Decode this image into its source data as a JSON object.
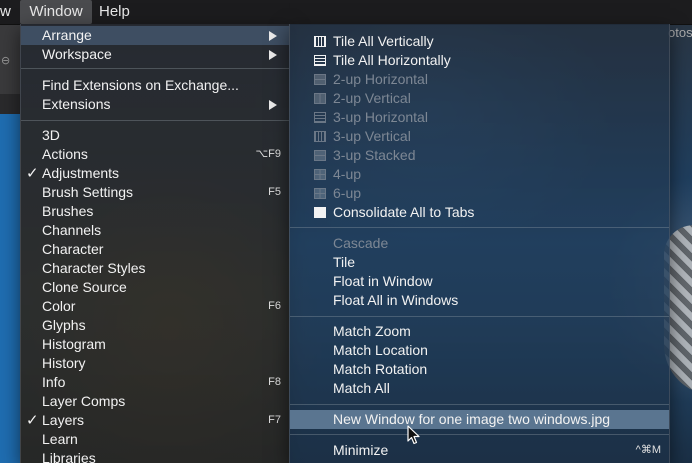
{
  "menubar": {
    "prev_fragment": "w",
    "window": "Window",
    "help": "Help"
  },
  "right_tab": "otos",
  "window_menu": {
    "items": [
      {
        "label": "Arrange",
        "submenu": true
      },
      {
        "label": "Workspace",
        "submenu": true
      },
      {
        "label": "Find Extensions on Exchange..."
      },
      {
        "label": "Extensions",
        "submenu": true
      },
      {
        "label": "3D"
      },
      {
        "label": "Actions",
        "shortcut": "⌥F9"
      },
      {
        "label": "Adjustments",
        "checked": true
      },
      {
        "label": "Brush Settings",
        "shortcut": "F5"
      },
      {
        "label": "Brushes"
      },
      {
        "label": "Channels"
      },
      {
        "label": "Character"
      },
      {
        "label": "Character Styles"
      },
      {
        "label": "Clone Source"
      },
      {
        "label": "Color",
        "shortcut": "F6"
      },
      {
        "label": "Glyphs"
      },
      {
        "label": "Histogram"
      },
      {
        "label": "History"
      },
      {
        "label": "Info",
        "shortcut": "F8"
      },
      {
        "label": "Layer Comps"
      },
      {
        "label": "Layers",
        "shortcut": "F7",
        "checked": true
      },
      {
        "label": "Learn"
      },
      {
        "label": "Libraries"
      }
    ],
    "check_glyph": "✓"
  },
  "arrange_menu": {
    "items": [
      {
        "label": "Tile All Vertically",
        "icon": "tile-vertical-icon"
      },
      {
        "label": "Tile All Horizontally",
        "icon": "tile-horizontal-icon"
      },
      {
        "label": "2-up Horizontal",
        "icon": "two-up-horizontal-icon",
        "disabled": true
      },
      {
        "label": "2-up Vertical",
        "icon": "two-up-vertical-icon",
        "disabled": true
      },
      {
        "label": "3-up Horizontal",
        "icon": "three-up-horizontal-icon",
        "disabled": true
      },
      {
        "label": "3-up Vertical",
        "icon": "three-up-vertical-icon",
        "disabled": true
      },
      {
        "label": "3-up Stacked",
        "icon": "three-up-stacked-icon",
        "disabled": true
      },
      {
        "label": "4-up",
        "icon": "four-up-icon",
        "disabled": true
      },
      {
        "label": "6-up",
        "icon": "six-up-icon",
        "disabled": true
      },
      {
        "label": "Consolidate All to Tabs",
        "icon": "consolidate-tabs-icon"
      },
      {
        "label": "Cascade",
        "disabled": true
      },
      {
        "label": "Tile"
      },
      {
        "label": "Float in Window"
      },
      {
        "label": "Float All in Windows"
      },
      {
        "label": "Match Zoom"
      },
      {
        "label": "Match Location"
      },
      {
        "label": "Match Rotation"
      },
      {
        "label": "Match All"
      },
      {
        "label": "New Window for one image two windows.jpg",
        "highlighted": true
      },
      {
        "label": "Minimize",
        "shortcut": "^⌘M"
      }
    ]
  },
  "colors": {
    "highlight": "#5a7590",
    "menubar_active": "#4a4b4e"
  }
}
